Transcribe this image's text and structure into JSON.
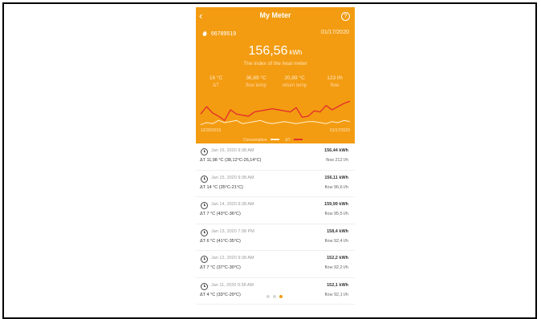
{
  "header": {
    "title": "My Meter",
    "back_icon": "chevron-left-icon",
    "help_icon": "question-circle-icon"
  },
  "meter": {
    "id": "66789519",
    "date": "01/17/2020",
    "value": "156,56",
    "unit": "kWh",
    "description": "The index of the heat meter"
  },
  "stats": [
    {
      "value": "16 °C",
      "label": "ΔT"
    },
    {
      "value": "36,89 °C",
      "label": "flow temp"
    },
    {
      "value": "20,89 °C",
      "label": "return temp"
    },
    {
      "value": "123 l/h",
      "label": "flow"
    }
  ],
  "chart_data": {
    "type": "line",
    "x_start": "12/20/2019",
    "x_end": "01/17/2020",
    "series": [
      {
        "name": "Consumption",
        "color": "#fff0d0",
        "values": [
          4,
          6,
          5,
          8,
          6,
          7,
          8,
          5,
          6,
          7,
          8,
          6,
          5,
          6,
          7,
          6,
          5,
          6,
          7,
          7,
          6,
          5,
          7,
          6,
          8,
          7
        ]
      },
      {
        "name": "ΔT",
        "color": "#e4322b",
        "values": [
          14,
          21,
          15,
          12,
          8,
          18,
          14,
          13,
          12,
          16,
          17,
          18,
          19,
          18,
          17,
          16,
          20,
          11,
          12,
          17,
          16,
          22,
          18,
          21,
          24,
          26
        ]
      }
    ],
    "ylim": [
      0,
      30
    ]
  },
  "readings": [
    {
      "time": "Jan 16, 2020 9:38 AM",
      "delta": "ΔT  11,98 °C (38,12°C-26,14°C)",
      "kwh": "156,44 kWh",
      "flow": "flow  212 l/h"
    },
    {
      "time": "Jan 15, 2020 9:38 AM",
      "delta": "ΔT  14 °C (35°C-21°C)",
      "kwh": "156,11 kWh",
      "flow": "flow  96,6 l/h"
    },
    {
      "time": "Jan 14, 2020 9:38 AM",
      "delta": "ΔT  7 °C (43°C-36°C)",
      "kwh": "159,99 kWh",
      "flow": "flow  95,5 l/h"
    },
    {
      "time": "Jan 13, 2020 7:38 PM",
      "delta": "ΔT  6 °C (41°C-35°C)",
      "kwh": "158,4 kWh",
      "flow": "flow  92,4 l/h"
    },
    {
      "time": "Jan 12, 2020 9:38 AM",
      "delta": "ΔT  7 °C (37°C-30°C)",
      "kwh": "152,2 kWh",
      "flow": "flow  92,2 l/h"
    },
    {
      "time": "Jan 11, 2020 9:38 AM",
      "delta": "ΔT  4 °C (33°C-29°C)",
      "kwh": "152,1 kWh",
      "flow": "flow  92,1 l/h"
    }
  ],
  "pagination": {
    "active_index": 2,
    "count": 3
  }
}
